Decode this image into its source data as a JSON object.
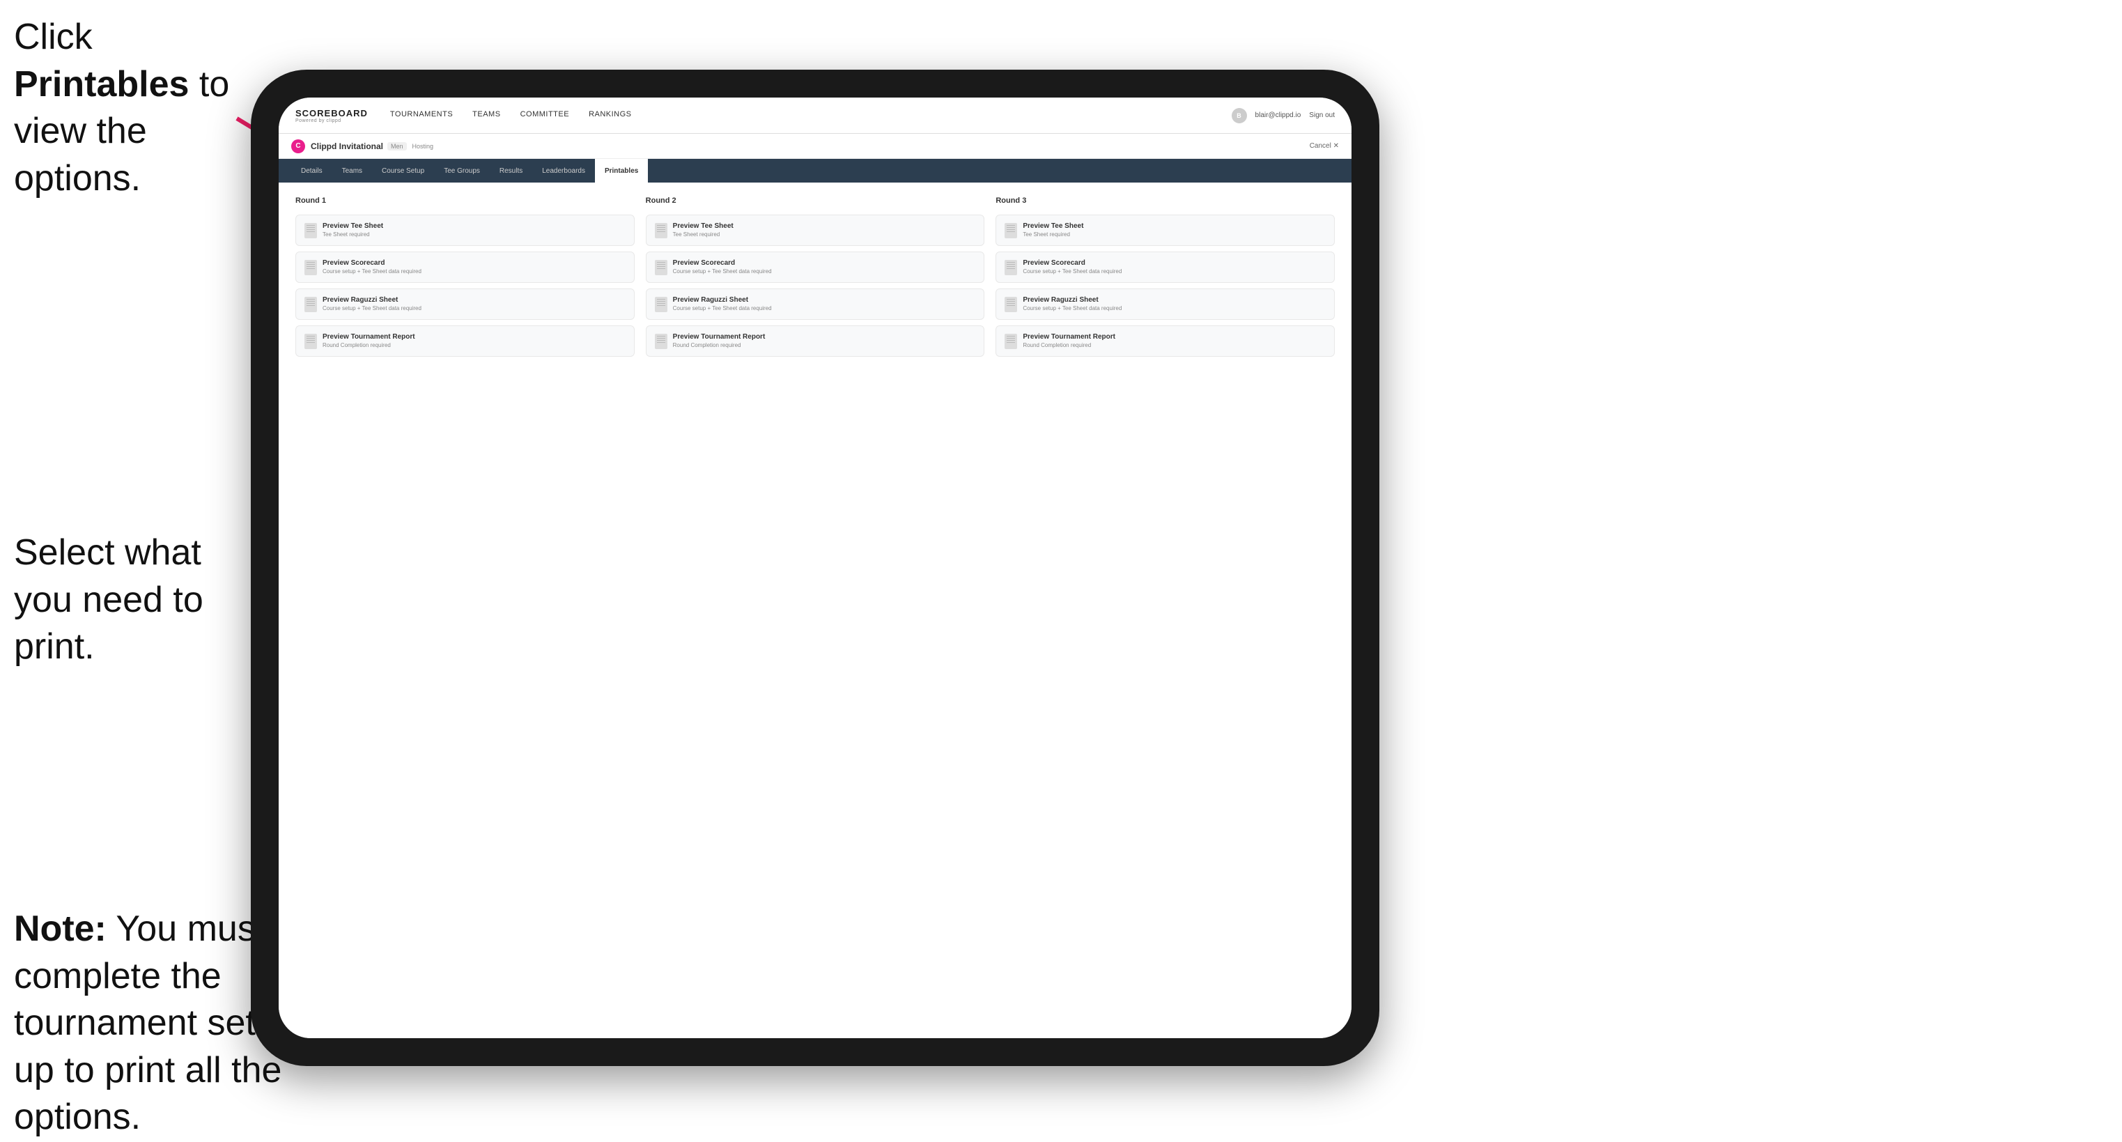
{
  "annotations": {
    "top": {
      "prefix": "Click ",
      "bold": "Printables",
      "suffix": " to view the options."
    },
    "middle": {
      "text": "Select what you need to print."
    },
    "bottom": {
      "bold_prefix": "Note:",
      "text": " You must complete the tournament set-up to print all the options."
    }
  },
  "top_nav": {
    "logo": "SCOREBOARD",
    "logo_sub": "Powered by clippd",
    "links": [
      {
        "label": "TOURNAMENTS",
        "active": false
      },
      {
        "label": "TEAMS",
        "active": false
      },
      {
        "label": "COMMITTEE",
        "active": false
      },
      {
        "label": "RANKINGS",
        "active": false
      }
    ],
    "user_email": "blair@clippd.io",
    "sign_out": "Sign out"
  },
  "tournament_bar": {
    "logo_letter": "C",
    "name": "Clippd Invitational",
    "badge": "Men",
    "status": "Hosting",
    "cancel": "Cancel ✕"
  },
  "sub_tabs": [
    {
      "label": "Details",
      "active": false
    },
    {
      "label": "Teams",
      "active": false
    },
    {
      "label": "Course Setup",
      "active": false
    },
    {
      "label": "Tee Groups",
      "active": false
    },
    {
      "label": "Results",
      "active": false
    },
    {
      "label": "Leaderboards",
      "active": false
    },
    {
      "label": "Printables",
      "active": true
    }
  ],
  "rounds": [
    {
      "title": "Round 1",
      "items": [
        {
          "title": "Preview Tee Sheet",
          "subtitle": "Tee Sheet required"
        },
        {
          "title": "Preview Scorecard",
          "subtitle": "Course setup + Tee Sheet data required"
        },
        {
          "title": "Preview Raguzzi Sheet",
          "subtitle": "Course setup + Tee Sheet data required"
        },
        {
          "title": "Preview Tournament Report",
          "subtitle": "Round Completion required"
        }
      ]
    },
    {
      "title": "Round 2",
      "items": [
        {
          "title": "Preview Tee Sheet",
          "subtitle": "Tee Sheet required"
        },
        {
          "title": "Preview Scorecard",
          "subtitle": "Course setup + Tee Sheet data required"
        },
        {
          "title": "Preview Raguzzi Sheet",
          "subtitle": "Course setup + Tee Sheet data required"
        },
        {
          "title": "Preview Tournament Report",
          "subtitle": "Round Completion required"
        }
      ]
    },
    {
      "title": "Round 3",
      "items": [
        {
          "title": "Preview Tee Sheet",
          "subtitle": "Tee Sheet required"
        },
        {
          "title": "Preview Scorecard",
          "subtitle": "Course setup + Tee Sheet data required"
        },
        {
          "title": "Preview Raguzzi Sheet",
          "subtitle": "Course setup + Tee Sheet data required"
        },
        {
          "title": "Preview Tournament Report",
          "subtitle": "Round Completion required"
        }
      ]
    }
  ]
}
